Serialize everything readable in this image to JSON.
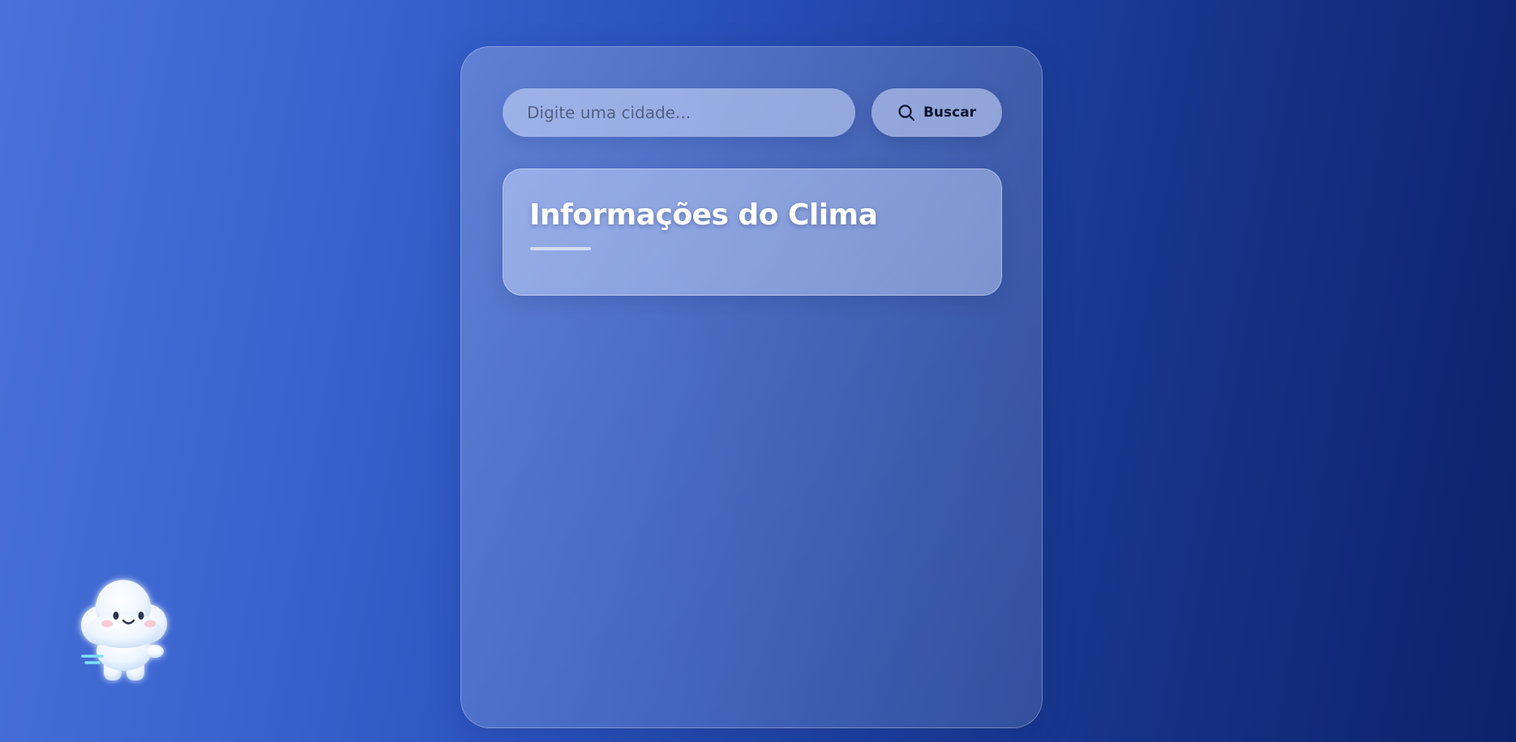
{
  "search": {
    "placeholder": "Digite uma cidade...",
    "value": "",
    "button_label": "Buscar",
    "button_icon": "search-icon"
  },
  "weather_info": {
    "title": "Informações do Clima"
  },
  "mascot": {
    "icon": "cloud-mascot-icon"
  },
  "colors": {
    "background_start": "#4a72d8",
    "background_end": "#0c236b",
    "title_text": "#ffffff",
    "button_text": "#0c1430"
  }
}
